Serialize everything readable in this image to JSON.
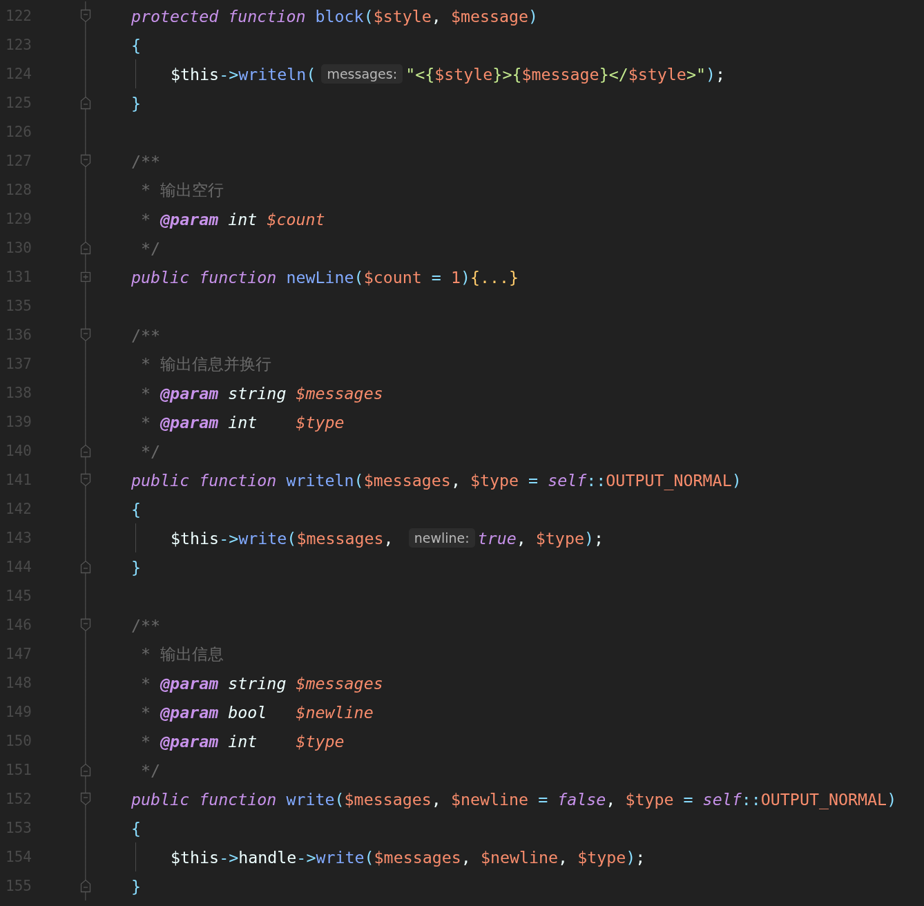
{
  "editor": {
    "lines": [
      {
        "number": "122",
        "fold": {
          "kind": "start"
        },
        "tokens": [
          {
            "kind": "kw",
            "text": "protected "
          },
          {
            "kind": "kw",
            "text": "function "
          },
          {
            "kind": "fn",
            "text": "block"
          },
          {
            "kind": "p",
            "text": "("
          },
          {
            "kind": "var",
            "text": "$style"
          },
          {
            "kind": "plain",
            "text": ", "
          },
          {
            "kind": "var",
            "text": "$message"
          },
          {
            "kind": "p",
            "text": ")"
          }
        ]
      },
      {
        "number": "123",
        "tokens": [
          {
            "kind": "p",
            "text": "{"
          }
        ]
      },
      {
        "number": "124",
        "guide": true,
        "tokens": [
          {
            "kind": "plain",
            "text": "$this"
          },
          {
            "kind": "p",
            "text": "->"
          },
          {
            "kind": "fn",
            "text": "writeln"
          },
          {
            "kind": "p",
            "text": "("
          },
          {
            "kind": "hint",
            "text": "messages:"
          },
          {
            "kind": "str",
            "text": "\"<{"
          },
          {
            "kind": "var",
            "text": "$style"
          },
          {
            "kind": "str",
            "text": "}>{"
          },
          {
            "kind": "var",
            "text": "$message"
          },
          {
            "kind": "str",
            "text": "}</"
          },
          {
            "kind": "var",
            "text": "$style"
          },
          {
            "kind": "str",
            "text": ">\""
          },
          {
            "kind": "p",
            "text": ")"
          },
          {
            "kind": "plain",
            "text": ";"
          }
        ]
      },
      {
        "number": "125",
        "fold": {
          "kind": "end"
        },
        "tokens": [
          {
            "kind": "p",
            "text": "}"
          }
        ]
      },
      {
        "number": "126"
      },
      {
        "number": "127",
        "fold": {
          "kind": "start"
        },
        "tokens": [
          {
            "kind": "cm",
            "text": "/**"
          }
        ]
      },
      {
        "number": "128",
        "tokens": [
          {
            "kind": "cm",
            "text": " * 输出空行"
          }
        ]
      },
      {
        "number": "129",
        "tokens": [
          {
            "kind": "cm",
            "text": " * "
          },
          {
            "kind": "tag",
            "text": "@param"
          },
          {
            "kind": "type",
            "text": " int "
          },
          {
            "kind": "docvar",
            "text": "$count"
          }
        ]
      },
      {
        "number": "130",
        "fold": {
          "kind": "end"
        },
        "tokens": [
          {
            "kind": "cm",
            "text": " */"
          }
        ]
      },
      {
        "number": "131",
        "fold": {
          "kind": "collapsed"
        },
        "tokens": [
          {
            "kind": "kw",
            "text": "public "
          },
          {
            "kind": "kw",
            "text": "function "
          },
          {
            "kind": "fn",
            "text": "newLine"
          },
          {
            "kind": "p",
            "text": "("
          },
          {
            "kind": "var",
            "text": "$count"
          },
          {
            "kind": "p",
            "text": " = "
          },
          {
            "kind": "num",
            "text": "1"
          },
          {
            "kind": "p",
            "text": ")"
          },
          {
            "kind": "folded",
            "text": "{...}"
          }
        ]
      },
      {
        "number": "135"
      },
      {
        "number": "136",
        "fold": {
          "kind": "start"
        },
        "tokens": [
          {
            "kind": "cm",
            "text": "/**"
          }
        ]
      },
      {
        "number": "137",
        "tokens": [
          {
            "kind": "cm",
            "text": " * 输出信息并换行"
          }
        ]
      },
      {
        "number": "138",
        "tokens": [
          {
            "kind": "cm",
            "text": " * "
          },
          {
            "kind": "tag",
            "text": "@param"
          },
          {
            "kind": "type",
            "text": " string "
          },
          {
            "kind": "docvar",
            "text": "$messages"
          }
        ]
      },
      {
        "number": "139",
        "tokens": [
          {
            "kind": "cm",
            "text": " * "
          },
          {
            "kind": "tag",
            "text": "@param"
          },
          {
            "kind": "type",
            "text": " int    "
          },
          {
            "kind": "docvar",
            "text": "$type"
          }
        ]
      },
      {
        "number": "140",
        "fold": {
          "kind": "end"
        },
        "tokens": [
          {
            "kind": "cm",
            "text": " */"
          }
        ]
      },
      {
        "number": "141",
        "fold": {
          "kind": "start"
        },
        "tokens": [
          {
            "kind": "kw",
            "text": "public "
          },
          {
            "kind": "kw",
            "text": "function "
          },
          {
            "kind": "fn",
            "text": "writeln"
          },
          {
            "kind": "p",
            "text": "("
          },
          {
            "kind": "var",
            "text": "$messages"
          },
          {
            "kind": "plain",
            "text": ", "
          },
          {
            "kind": "var",
            "text": "$type"
          },
          {
            "kind": "p",
            "text": " = "
          },
          {
            "kind": "kw",
            "text": "self"
          },
          {
            "kind": "p",
            "text": "::"
          },
          {
            "kind": "const",
            "text": "OUTPUT_NORMAL"
          },
          {
            "kind": "p",
            "text": ")"
          }
        ]
      },
      {
        "number": "142",
        "tokens": [
          {
            "kind": "p",
            "text": "{"
          }
        ]
      },
      {
        "number": "143",
        "guide": true,
        "tokens": [
          {
            "kind": "plain",
            "text": "$this"
          },
          {
            "kind": "p",
            "text": "->"
          },
          {
            "kind": "fn",
            "text": "write"
          },
          {
            "kind": "p",
            "text": "("
          },
          {
            "kind": "var",
            "text": "$messages"
          },
          {
            "kind": "plain",
            "text": ", "
          },
          {
            "kind": "hint",
            "text": "newline:"
          },
          {
            "kind": "kw",
            "text": "true"
          },
          {
            "kind": "plain",
            "text": ", "
          },
          {
            "kind": "var",
            "text": "$type"
          },
          {
            "kind": "p",
            "text": ")"
          },
          {
            "kind": "plain",
            "text": ";"
          }
        ]
      },
      {
        "number": "144",
        "fold": {
          "kind": "end"
        },
        "tokens": [
          {
            "kind": "p",
            "text": "}"
          }
        ]
      },
      {
        "number": "145"
      },
      {
        "number": "146",
        "fold": {
          "kind": "start"
        },
        "tokens": [
          {
            "kind": "cm",
            "text": "/**"
          }
        ]
      },
      {
        "number": "147",
        "tokens": [
          {
            "kind": "cm",
            "text": " * 输出信息"
          }
        ]
      },
      {
        "number": "148",
        "tokens": [
          {
            "kind": "cm",
            "text": " * "
          },
          {
            "kind": "tag",
            "text": "@param"
          },
          {
            "kind": "type",
            "text": " string "
          },
          {
            "kind": "docvar",
            "text": "$messages"
          }
        ]
      },
      {
        "number": "149",
        "tokens": [
          {
            "kind": "cm",
            "text": " * "
          },
          {
            "kind": "tag",
            "text": "@param"
          },
          {
            "kind": "type",
            "text": " bool   "
          },
          {
            "kind": "docvar",
            "text": "$newline"
          }
        ]
      },
      {
        "number": "150",
        "tokens": [
          {
            "kind": "cm",
            "text": " * "
          },
          {
            "kind": "tag",
            "text": "@param"
          },
          {
            "kind": "type",
            "text": " int    "
          },
          {
            "kind": "docvar",
            "text": "$type"
          }
        ]
      },
      {
        "number": "151",
        "fold": {
          "kind": "end"
        },
        "tokens": [
          {
            "kind": "cm",
            "text": " */"
          }
        ]
      },
      {
        "number": "152",
        "fold": {
          "kind": "start"
        },
        "tokens": [
          {
            "kind": "kw",
            "text": "public "
          },
          {
            "kind": "kw",
            "text": "function "
          },
          {
            "kind": "fn",
            "text": "write"
          },
          {
            "kind": "p",
            "text": "("
          },
          {
            "kind": "var",
            "text": "$messages"
          },
          {
            "kind": "plain",
            "text": ", "
          },
          {
            "kind": "var",
            "text": "$newline"
          },
          {
            "kind": "p",
            "text": " = "
          },
          {
            "kind": "kw",
            "text": "false"
          },
          {
            "kind": "plain",
            "text": ", "
          },
          {
            "kind": "var",
            "text": "$type"
          },
          {
            "kind": "p",
            "text": " = "
          },
          {
            "kind": "kw",
            "text": "self"
          },
          {
            "kind": "p",
            "text": "::"
          },
          {
            "kind": "const",
            "text": "OUTPUT_NORMAL"
          },
          {
            "kind": "p",
            "text": ")"
          }
        ]
      },
      {
        "number": "153",
        "tokens": [
          {
            "kind": "p",
            "text": "{"
          }
        ]
      },
      {
        "number": "154",
        "guide": true,
        "tokens": [
          {
            "kind": "plain",
            "text": "$this"
          },
          {
            "kind": "p",
            "text": "->"
          },
          {
            "kind": "plain",
            "text": "handle"
          },
          {
            "kind": "p",
            "text": "->"
          },
          {
            "kind": "fn",
            "text": "write"
          },
          {
            "kind": "p",
            "text": "("
          },
          {
            "kind": "var",
            "text": "$messages"
          },
          {
            "kind": "plain",
            "text": ", "
          },
          {
            "kind": "var",
            "text": "$newline"
          },
          {
            "kind": "plain",
            "text": ", "
          },
          {
            "kind": "var",
            "text": "$type"
          },
          {
            "kind": "p",
            "text": ")"
          },
          {
            "kind": "plain",
            "text": ";"
          }
        ]
      },
      {
        "number": "155",
        "fold": {
          "kind": "end"
        },
        "tokens": [
          {
            "kind": "p",
            "text": "}"
          }
        ]
      }
    ]
  }
}
